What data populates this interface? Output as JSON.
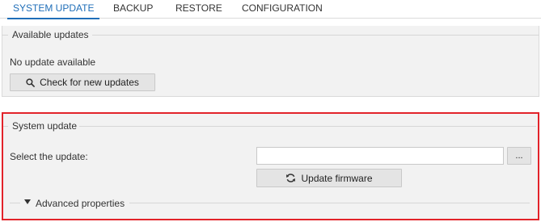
{
  "tabs": [
    {
      "label": "SYSTEM UPDATE",
      "active": true
    },
    {
      "label": "BACKUP",
      "active": false
    },
    {
      "label": "RESTORE",
      "active": false
    },
    {
      "label": "CONFIGURATION",
      "active": false
    }
  ],
  "available_updates": {
    "title": "Available updates",
    "status": "No update available",
    "check_button": {
      "label": "Check for new updates",
      "icon": "search-icon"
    }
  },
  "system_update": {
    "title": "System update",
    "select_label": "Select the update:",
    "file_input": {
      "value": "",
      "placeholder": ""
    },
    "browse_button": {
      "label": "..."
    },
    "update_button": {
      "label": "Update firmware",
      "icon": "refresh-icon"
    },
    "advanced": {
      "label": "Advanced properties",
      "icon": "triangle-down-icon",
      "expanded": false
    }
  },
  "colors": {
    "accent": "#1f6eb8",
    "highlight_frame": "#e2232a",
    "panel_background": "#f2f2f2",
    "button_background": "#e4e4e4"
  }
}
